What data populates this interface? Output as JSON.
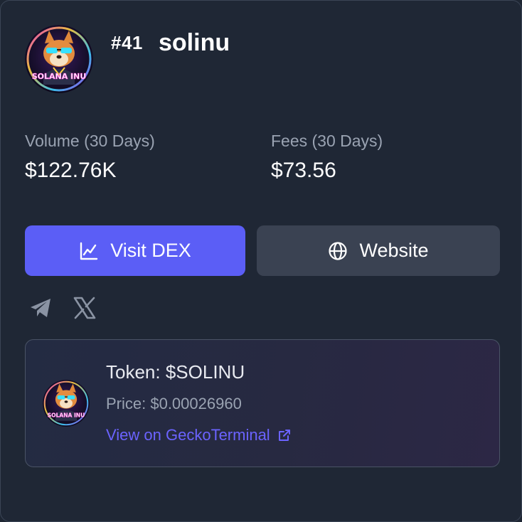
{
  "project": {
    "rank": "#41",
    "name": "solinu",
    "avatar_icon": "shiba-inu-logo-icon",
    "avatar_caption": "SOLANA INU"
  },
  "stats": {
    "volume_label": "Volume (30 Days)",
    "volume_value": "$122.76K",
    "fees_label": "Fees (30 Days)",
    "fees_value": "$73.56"
  },
  "actions": {
    "dex_label": "Visit DEX",
    "dex_icon": "line-chart-icon",
    "website_label": "Website",
    "website_icon": "globe-icon"
  },
  "social": {
    "telegram_icon": "telegram-icon",
    "x_icon": "x-icon"
  },
  "token": {
    "title": "Token: $SOLINU",
    "price": "Price: $0.00026960",
    "link_label": "View on GeckoTerminal",
    "link_icon": "external-link-icon"
  },
  "colors": {
    "background": "#1f2735",
    "accent": "#5b5ef6",
    "secondary_button": "#3a4252",
    "link": "#6b63ff",
    "muted_text": "#9aa3b2"
  }
}
